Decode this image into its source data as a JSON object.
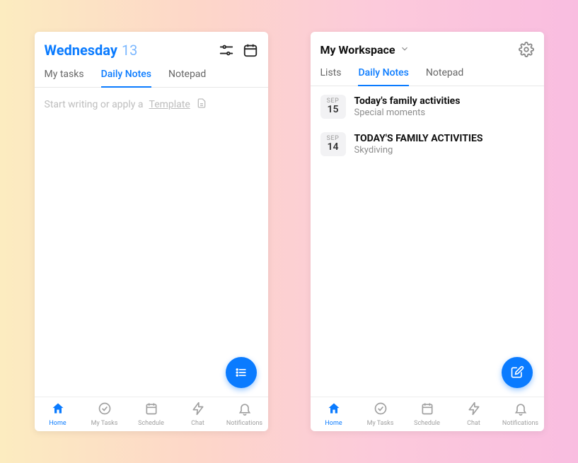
{
  "left": {
    "header": {
      "day_name": "Wednesday",
      "day_number": "13"
    },
    "tabs": [
      "My tasks",
      "Daily Notes",
      "Notepad"
    ],
    "active_tab": 1,
    "placeholder_prefix": "Start writing or apply a ",
    "placeholder_link": "Template"
  },
  "right": {
    "header": {
      "title": "My Workspace"
    },
    "tabs": [
      "Lists",
      "Daily Notes",
      "Notepad"
    ],
    "active_tab": 1,
    "notes": [
      {
        "month": "SEP",
        "day": "15",
        "title": "Today's family activities",
        "subtitle": "Special moments"
      },
      {
        "month": "SEP",
        "day": "14",
        "title": "TODAY'S FAMILY ACTIVITIES",
        "subtitle": "Skydiving"
      }
    ]
  },
  "bottom_nav": [
    {
      "label": "Home",
      "icon": "home"
    },
    {
      "label": "My Tasks",
      "icon": "check"
    },
    {
      "label": "Schedule",
      "icon": "calendar"
    },
    {
      "label": "Chat",
      "icon": "bolt"
    },
    {
      "label": "Notifications",
      "icon": "bell"
    }
  ],
  "active_nav": 0
}
